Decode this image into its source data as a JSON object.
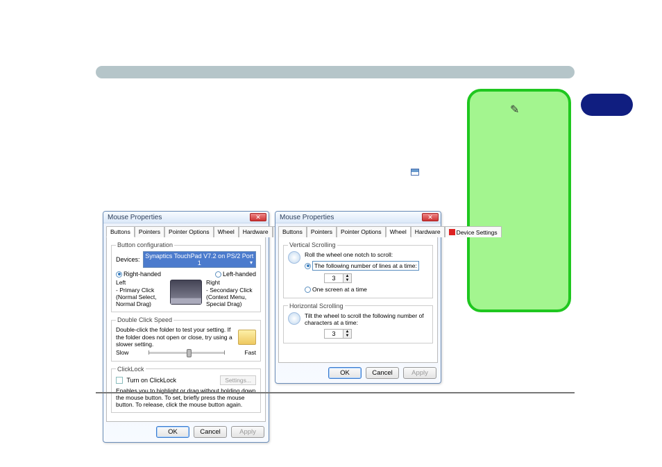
{
  "dialog_title": "Mouse Properties",
  "tabs": {
    "buttons": "Buttons",
    "pointers": "Pointers",
    "pointer_options": "Pointer Options",
    "wheel": "Wheel",
    "hardware": "Hardware",
    "device_settings": "Device Settings"
  },
  "buttons_tab": {
    "group_config": "Button configuration",
    "devices_label": "Devices:",
    "device_value": "Synaptics TouchPad V7.2 on PS/2 Port 1",
    "right_handed": "Right-handed",
    "left_handed": "Left-handed",
    "left_col_title": "Left",
    "left_col_desc": "- Primary Click (Normal Select, Normal Drag)",
    "right_col_title": "Right",
    "right_col_desc": "- Secondary Click (Context Menu, Special Drag)",
    "group_dbl": "Double Click Speed",
    "dbl_desc": "Double-click the folder to test your setting. If the folder does not open or close, try using a slower setting.",
    "slow": "Slow",
    "fast": "Fast",
    "group_clicklock": "ClickLock",
    "clicklock_toggle": "Turn on ClickLock",
    "clicklock_settings": "Settings...",
    "clicklock_desc": "Enables you to highlight or drag without holding down the mouse button. To set, briefly press the mouse button. To release, click the mouse button again."
  },
  "wheel_tab": {
    "group_vert": "Vertical Scrolling",
    "vert_desc": "Roll the wheel one notch to scroll:",
    "vert_opt_lines": "The following number of lines at a time:",
    "vert_lines_value": "3",
    "vert_opt_screen": "One screen at a time",
    "group_horiz": "Horizontal Scrolling",
    "horiz_desc": "Tilt the wheel to scroll the following number of characters at a time:",
    "horiz_value": "3"
  },
  "buttons": {
    "ok": "OK",
    "cancel": "Cancel",
    "apply": "Apply"
  }
}
